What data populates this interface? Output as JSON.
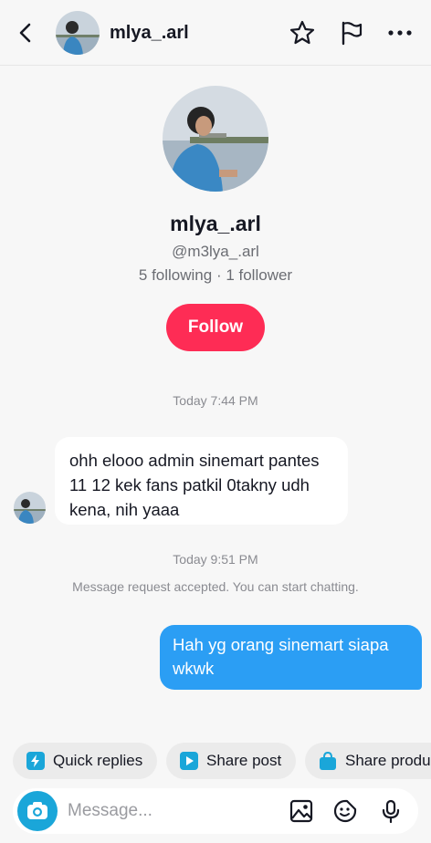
{
  "header": {
    "back_icon": "chevron-left-icon",
    "username": "mlya_.arl",
    "icons": [
      "star-icon",
      "flag-icon",
      "more-icon"
    ]
  },
  "profile": {
    "display_name": "mlya_.arl",
    "handle": "@m3lya_.arl",
    "stats": "5 following · 1 follower",
    "follow_label": "Follow",
    "follow_color": "#fe2c55"
  },
  "conversation": {
    "timestamp_1": "Today 7:44 PM",
    "incoming_message": "ohh elooo admin sinemart pantes 11 12 kek fans patkil 0takny udh kena, nih yaaa",
    "timestamp_2": "Today 9:51 PM",
    "system_message": "Message request accepted. You can start chatting.",
    "outgoing_message": "Hah yg orang sinemart siapa wkwk",
    "outgoing_color": "#2b9ef4"
  },
  "quick_actions": [
    {
      "label": "Quick replies",
      "icon": "lightning-icon"
    },
    {
      "label": "Share post",
      "icon": "play-icon"
    },
    {
      "label": "Share produ",
      "icon": "shopping-bag-icon"
    }
  ],
  "composer": {
    "placeholder": "Message...",
    "icons": [
      "camera-icon",
      "image-icon",
      "sticker-icon",
      "microphone-icon"
    ]
  }
}
